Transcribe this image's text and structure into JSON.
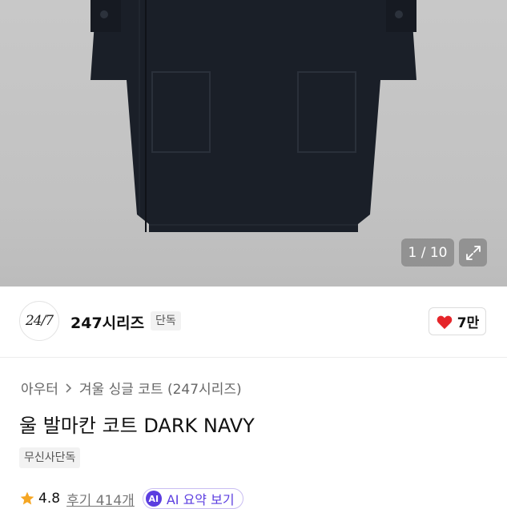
{
  "gallery": {
    "counter": "1 / 10",
    "image_alt": "dark navy wool coat",
    "expand_icon": "expand-icon"
  },
  "brand": {
    "logo_text": "24/7",
    "name": "247시리즈",
    "badge": "단독"
  },
  "like": {
    "icon": "heart-icon",
    "count": "7만",
    "color": "#e5252a"
  },
  "breadcrumb": {
    "items": [
      "아우터",
      "겨울 싱글 코트 (247시리즈)"
    ]
  },
  "product": {
    "title": "울 발마칸 코트 DARK NAVY",
    "exclusive_badge": "무신사단독"
  },
  "rating": {
    "score": "4.8",
    "reviews": "후기 414개",
    "star_color": "#f5a623"
  },
  "ai_summary": {
    "badge": "AI",
    "label": "AI 요약 보기",
    "accent": "#5b3de0"
  }
}
